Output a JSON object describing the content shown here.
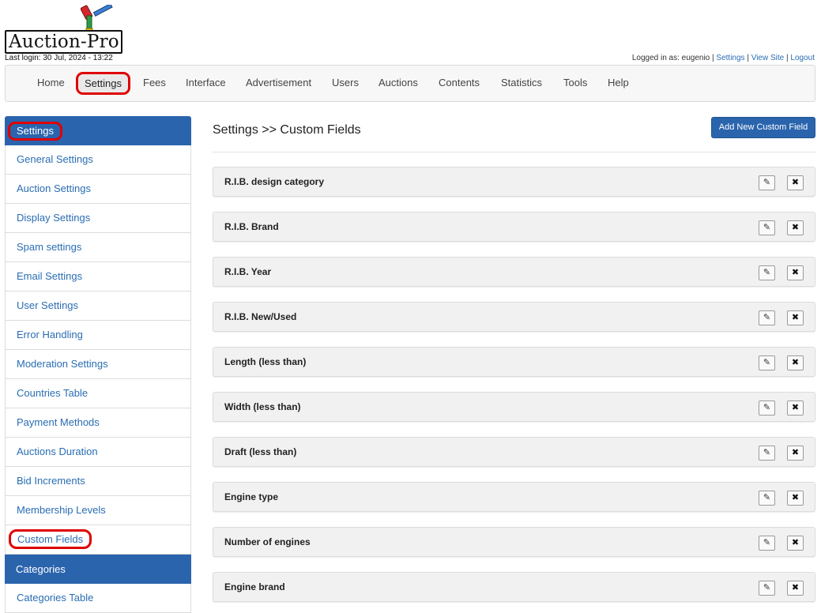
{
  "header": {
    "logo_text": "Auction-Pro",
    "last_login": "Last login: 30 Jul, 2024 - 13:22",
    "logged_in_as": "Logged in as: eugenio |",
    "links": [
      "Settings",
      "View Site",
      "Logout"
    ],
    "separator": "|"
  },
  "topnav": {
    "items": [
      "Home",
      "Settings",
      "Fees",
      "Interface",
      "Advertisement",
      "Users",
      "Auctions",
      "Contents",
      "Statistics",
      "Tools",
      "Help"
    ],
    "active": "Settings"
  },
  "sidebar": {
    "settings_header": "Settings",
    "settings_items": [
      "General Settings",
      "Auction Settings",
      "Display Settings",
      "Spam settings",
      "Email Settings",
      "User Settings",
      "Error Handling",
      "Moderation Settings",
      "Countries Table",
      "Payment Methods",
      "Auctions Duration",
      "Bid Increments",
      "Membership Levels",
      "Custom Fields"
    ],
    "categories_header": "Categories",
    "categories_items": [
      "Categories Table"
    ]
  },
  "main": {
    "title": "Settings >> Custom Fields",
    "add_button": "Add New Custom Field",
    "fields": [
      "R.I.B. design category",
      "R.I.B. Brand",
      "R.I.B. Year",
      "R.I.B. New/Used",
      "Length (less than)",
      "Width (less than)",
      "Draft (less than)",
      "Engine type",
      "Number of engines",
      "Engine brand"
    ],
    "edit_glyph": "✎",
    "delete_glyph": "✖"
  },
  "colors": {
    "primary": "#2a64ad",
    "link": "#2a6db3",
    "highlight_ring": "#e00000"
  },
  "icons": {
    "edit": "pencil-icon",
    "delete": "close-icon",
    "logo": "gavel-icon"
  }
}
